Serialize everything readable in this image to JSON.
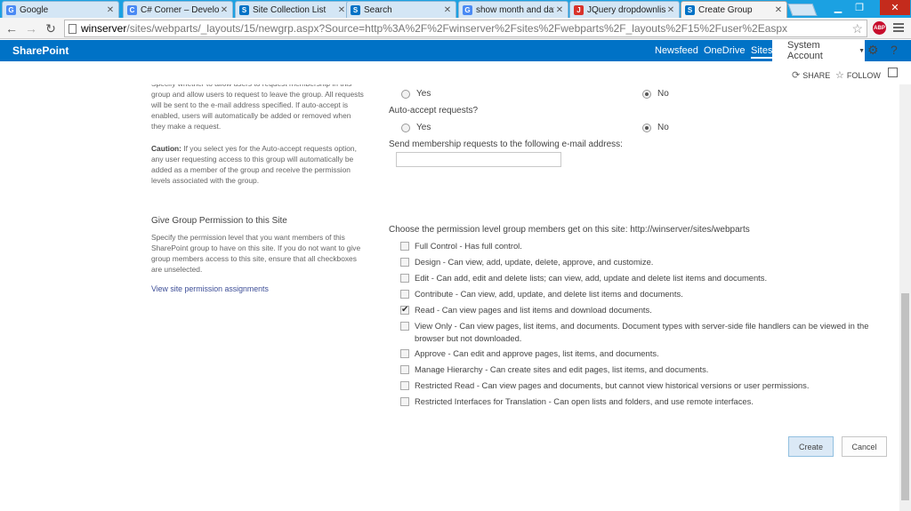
{
  "browser": {
    "tabs": [
      {
        "label": "Google",
        "fav": "G",
        "color": "#4a8af4"
      },
      {
        "label": "C# Corner – Develope",
        "fav": "C",
        "color": "#4a8af4"
      },
      {
        "label": "Site Collection List",
        "fav": "S",
        "color": "#0072c6"
      },
      {
        "label": "Search",
        "fav": "S",
        "color": "#0072c6"
      },
      {
        "label": "show month and dat",
        "fav": "G",
        "color": "#4a8af4"
      },
      {
        "label": "JQuery dropdownlist",
        "fav": "J",
        "color": "#d9322a"
      },
      {
        "label": "Create Group",
        "fav": "S",
        "color": "#0072c6"
      }
    ],
    "url_host": "winserver",
    "url_path": "/sites/webparts/_layouts/15/newgrp.aspx?Source=http%3A%2F%2Fwinserver%2Fsites%2Fwebparts%2F_layouts%2F15%2Fuser%2Easpx",
    "abp_label": "ABP"
  },
  "suitebar": {
    "brand": "SharePoint",
    "links": [
      "Newsfeed",
      "OneDrive",
      "Sites"
    ],
    "account": "System Account"
  },
  "actions": {
    "share": "SHARE",
    "follow": "FOLLOW"
  },
  "membership": {
    "desc_top": "Specify whether to allow users to request membership in this group and allow users to request to leave the group. All requests will be sent to the e-mail address specified. If auto-accept is enabled, users will automatically be added or removed when they make a request.",
    "caution_label": "Caution:",
    "caution_text": " If you select yes for the Auto-accept requests option, any user requesting access to this group will automatically be added as a member of the group and receive the permission levels associated with the group.",
    "yes": "Yes",
    "no": "No",
    "auto_accept_label": "Auto-accept requests?",
    "email_label": "Send membership requests to the following e-mail address:"
  },
  "permission": {
    "title": "Give Group Permission to this Site",
    "desc": "Specify the permission level that you want members of this SharePoint group to have on this site. If you do not want to give group members access to this site, ensure that all checkboxes are unselected.",
    "link": "View site permission assignments",
    "choose_label": "Choose the permission level group members get on this site: http://winserver/sites/webparts",
    "levels": [
      {
        "text": "Full Control - Has full control.",
        "checked": false
      },
      {
        "text": "Design - Can view, add, update, delete, approve, and customize.",
        "checked": false
      },
      {
        "text": "Edit - Can add, edit and delete lists; can view, add, update and delete list items and documents.",
        "checked": false
      },
      {
        "text": "Contribute - Can view, add, update, and delete list items and documents.",
        "checked": false
      },
      {
        "text": "Read - Can view pages and list items and download documents.",
        "checked": true
      },
      {
        "text": "View Only - Can view pages, list items, and documents. Document types with server-side file handlers can be viewed in the browser but not downloaded.",
        "checked": false
      },
      {
        "text": "Approve - Can edit and approve pages, list items, and documents.",
        "checked": false
      },
      {
        "text": "Manage Hierarchy - Can create sites and edit pages, list items, and documents.",
        "checked": false
      },
      {
        "text": "Restricted Read - Can view pages and documents, but cannot view historical versions or user permissions.",
        "checked": false
      },
      {
        "text": "Restricted Interfaces for Translation - Can open lists and folders, and use remote interfaces.",
        "checked": false
      }
    ]
  },
  "buttons": {
    "create": "Create",
    "cancel": "Cancel"
  }
}
